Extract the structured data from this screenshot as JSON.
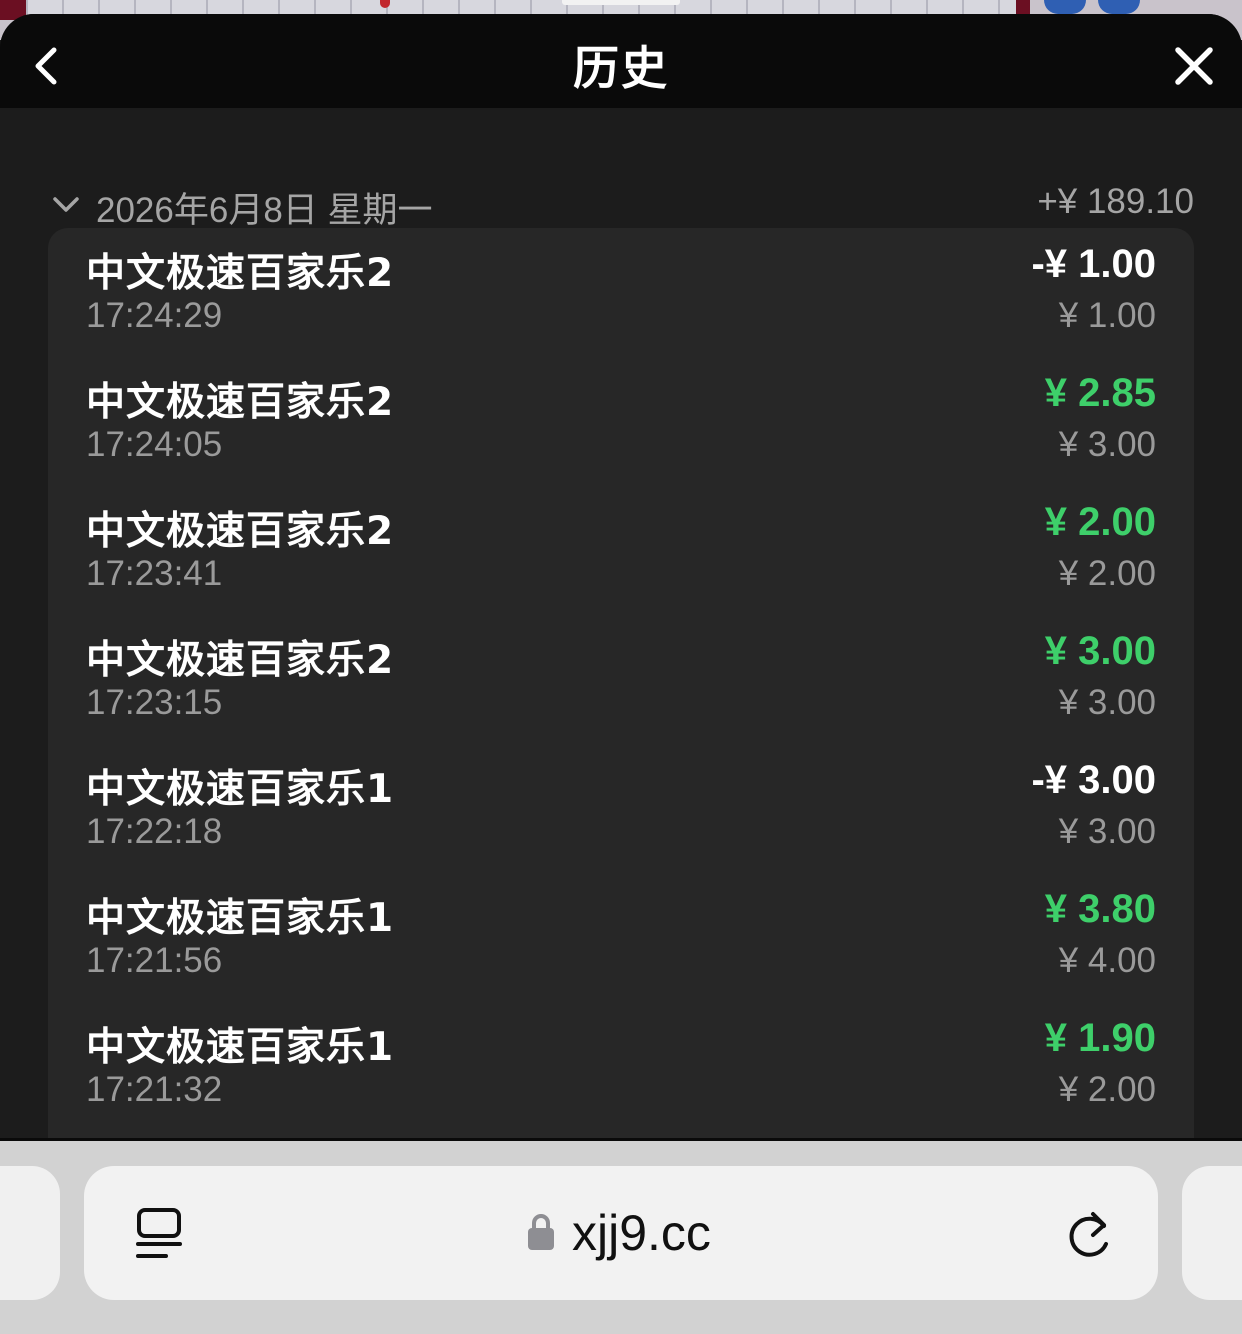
{
  "header": {
    "title": "历史"
  },
  "date_group": {
    "date": "2026年6月8日 星期一",
    "total": "+¥ 189.10"
  },
  "records": [
    {
      "game": "中文极速百家乐2",
      "time": "17:24:29",
      "result": "-¥ 1.00",
      "result_color": "#ffffff",
      "bet": "¥ 1.00"
    },
    {
      "game": "中文极速百家乐2",
      "time": "17:24:05",
      "result": "¥ 2.85",
      "result_color": "#3ecf6a",
      "bet": "¥ 3.00"
    },
    {
      "game": "中文极速百家乐2",
      "time": "17:23:41",
      "result": "¥ 2.00",
      "result_color": "#3ecf6a",
      "bet": "¥ 2.00"
    },
    {
      "game": "中文极速百家乐2",
      "time": "17:23:15",
      "result": "¥ 3.00",
      "result_color": "#3ecf6a",
      "bet": "¥ 3.00"
    },
    {
      "game": "中文极速百家乐1",
      "time": "17:22:18",
      "result": "-¥ 3.00",
      "result_color": "#ffffff",
      "bet": "¥ 3.00"
    },
    {
      "game": "中文极速百家乐1",
      "time": "17:21:56",
      "result": "¥ 3.80",
      "result_color": "#3ecf6a",
      "bet": "¥ 4.00"
    },
    {
      "game": "中文极速百家乐1",
      "time": "17:21:32",
      "result": "¥ 1.90",
      "result_color": "#3ecf6a",
      "bet": "¥ 2.00"
    }
  ],
  "browser": {
    "url": "xjj9.cc"
  },
  "colors": {
    "win": "#3ecf6a",
    "loss": "#ffffff",
    "muted": "#9a9a9a",
    "sheet_bg": "#1c1c1c",
    "card_bg": "#272727"
  }
}
